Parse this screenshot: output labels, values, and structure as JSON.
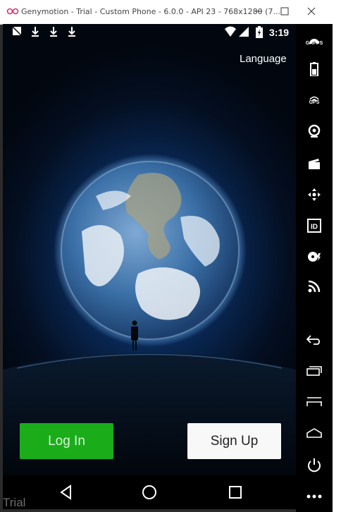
{
  "window": {
    "title": "Genymotion - Trial - Custom Phone - 6.0.0 - API 23 - 768x1280 (7...",
    "controls": [
      "minimize",
      "maximize",
      "close"
    ]
  },
  "status_bar": {
    "time": "3:19",
    "left_icons": [
      "no-sim-icon",
      "download-icon",
      "download-icon",
      "download-icon"
    ],
    "right_icons": [
      "wifi-icon",
      "signal-icon",
      "battery-charging-icon"
    ]
  },
  "app": {
    "language_label": "Language",
    "login_label": "Log In",
    "signup_label": "Sign Up",
    "colors": {
      "login": "#1aad19",
      "signup": "#f8f8f8"
    }
  },
  "nav_bar": {
    "buttons": [
      "back",
      "home",
      "recents"
    ]
  },
  "watermark": "Trial",
  "sidebar": {
    "gapps_label": "GAPPS",
    "gps_label": "GPS",
    "id_label": "ID",
    "items": [
      "gapps-icon",
      "battery-icon",
      "gps-icon",
      "camera-icon",
      "capture-icon",
      "remote-control-icon",
      "device-id-icon",
      "disk-io-icon",
      "network-icon",
      "back-icon",
      "recent-apps-icon",
      "menu-icon",
      "home-icon",
      "power-icon",
      "more-icon"
    ]
  }
}
